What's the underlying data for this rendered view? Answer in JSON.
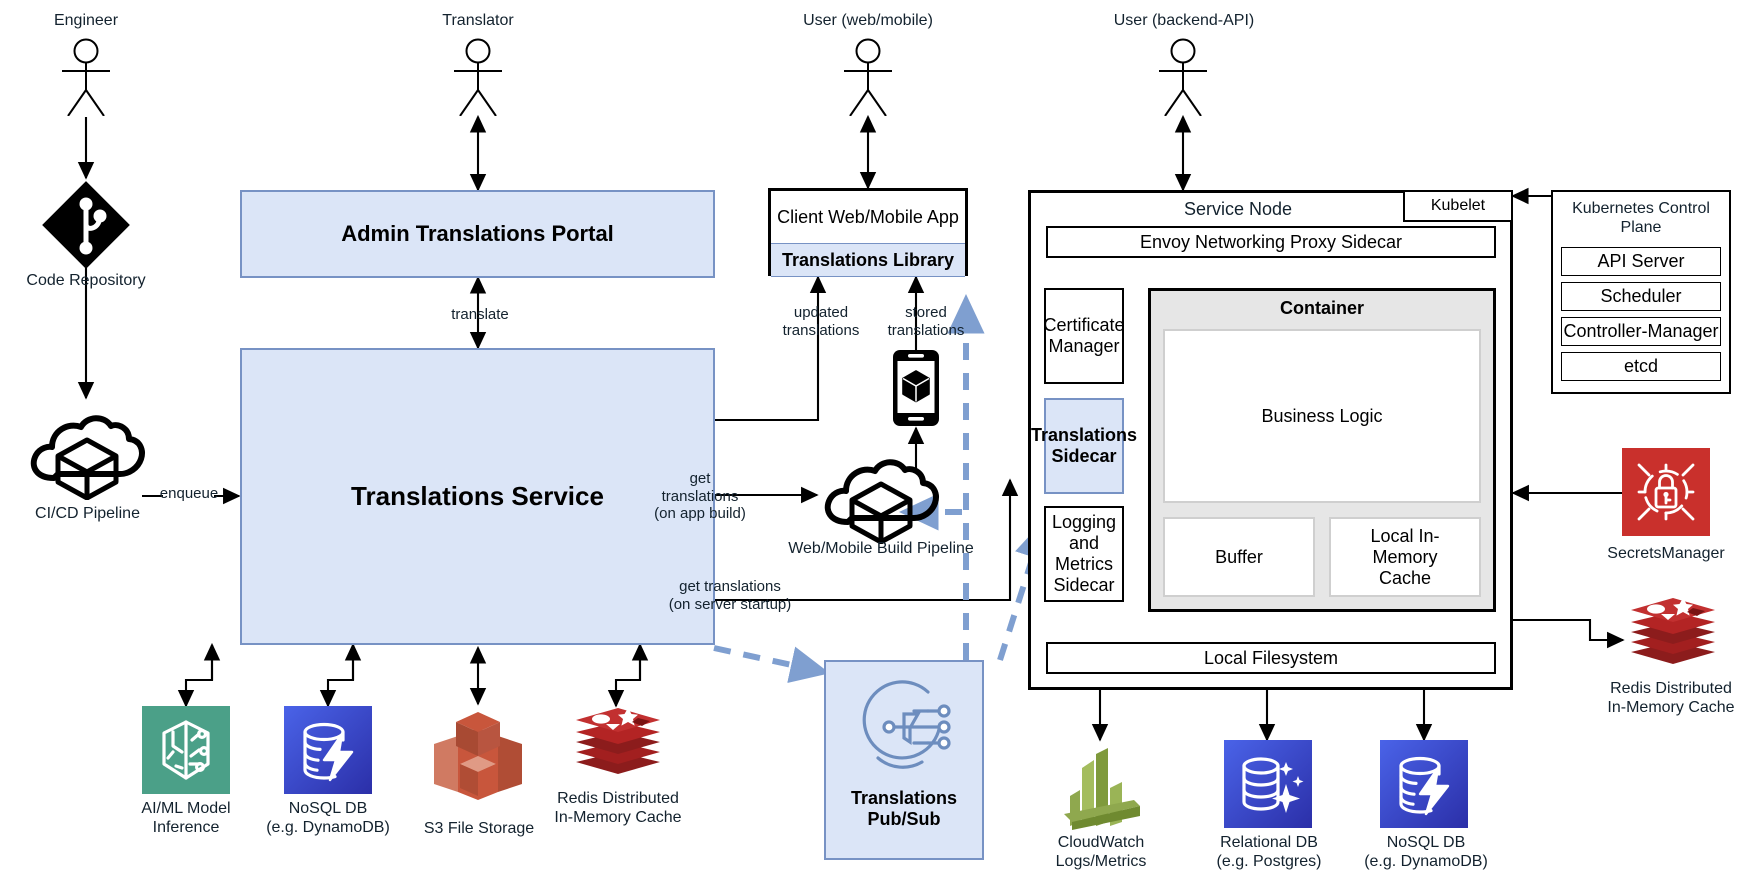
{
  "diagram": {
    "title": "Translations Service Architecture",
    "accent_blue": "#dbe5f7",
    "accent_blue_border": "#7792c4",
    "dashed_blue": "#7f9fd0"
  },
  "actors": [
    {
      "name": "actor-engineer",
      "label": "Engineer"
    },
    {
      "name": "actor-translator",
      "label": "Translator"
    },
    {
      "name": "actor-user-web",
      "label": "User (web/mobile)"
    },
    {
      "name": "actor-user-backend",
      "label": "User (backend-API)"
    }
  ],
  "left_column": {
    "code_repository": {
      "label": "Code Repository",
      "icon": "git-repository-icon"
    },
    "cicd_pipeline": {
      "label": "CI/CD Pipeline",
      "icon": "cloud-cube-icon"
    },
    "enqueue_edge": "enqueue",
    "translate_edge": "translate"
  },
  "core": {
    "admin_portal": "Admin Translations Portal",
    "translations_service": "Translations Service"
  },
  "service_datastores": [
    {
      "label": "AI/ML Model\nInference",
      "icon": "ai-brain-icon",
      "color": "#4ba088"
    },
    {
      "label": "NoSQL DB\n(e.g. DynamoDB)",
      "icon": "dynamodb-icon",
      "color": "#3b42c4"
    },
    {
      "label": "S3 File Storage",
      "icon": "s3-bucket-icon",
      "color": "#c8563c"
    },
    {
      "label": "Redis Distributed\nIn-Memory Cache",
      "icon": "redis-icon",
      "color": "#a21f1f"
    }
  ],
  "client": {
    "app_title": "Client Web/Mobile App",
    "library": "Translations Library",
    "updated_translations": "updated\ntranslations",
    "stored_translations": "stored\ntranslations",
    "device_icon": "mobile-device-icon",
    "build_pipeline": "Web/Mobile Build Pipeline",
    "build_pipeline_icon": "cloud-cube-icon",
    "get_translations_app": "get\ntranslations\n(on app build)"
  },
  "pubsub": {
    "label": "Translations\nPub/Sub",
    "icon": "pubsub-topic-icon"
  },
  "server": {
    "get_translations_server": "get translations\n(on server startup)",
    "service_node": "Service Node",
    "kubelet": "Kubelet",
    "envoy": "Envoy Networking Proxy Sidecar",
    "sidecars": [
      {
        "label": "Certificate\nManager",
        "highlight": false
      },
      {
        "label": "Translations\nSidecar",
        "highlight": true
      },
      {
        "label": "Logging and\nMetrics\nSidecar",
        "highlight": false
      }
    ],
    "container": "Container",
    "business_logic": "Business Logic",
    "buffer": "Buffer",
    "local_cache": "Local In-\nMemory\nCache",
    "local_filesystem": "Local Filesystem"
  },
  "control_plane": {
    "title": "Kubernetes Control\nPlane",
    "components": [
      "API Server",
      "Scheduler",
      "Controller-Manager",
      "etcd"
    ]
  },
  "right_services": [
    {
      "label": "SecretsManager",
      "icon": "secrets-manager-icon",
      "color": "#c9302c"
    },
    {
      "label": "Redis Distributed\nIn-Memory Cache",
      "icon": "redis-icon",
      "color": "#a21f1f"
    }
  ],
  "node_datastores": [
    {
      "label": "CloudWatch\nLogs/Metrics",
      "icon": "cloudwatch-icon",
      "color": "#7f9a3c"
    },
    {
      "label": "Relational DB\n(e.g. Postgres)",
      "icon": "relational-db-icon",
      "color": "#3b42c4"
    },
    {
      "label": "NoSQL DB\n(e.g. DynamoDB)",
      "icon": "dynamodb-icon",
      "color": "#3b42c4"
    }
  ]
}
